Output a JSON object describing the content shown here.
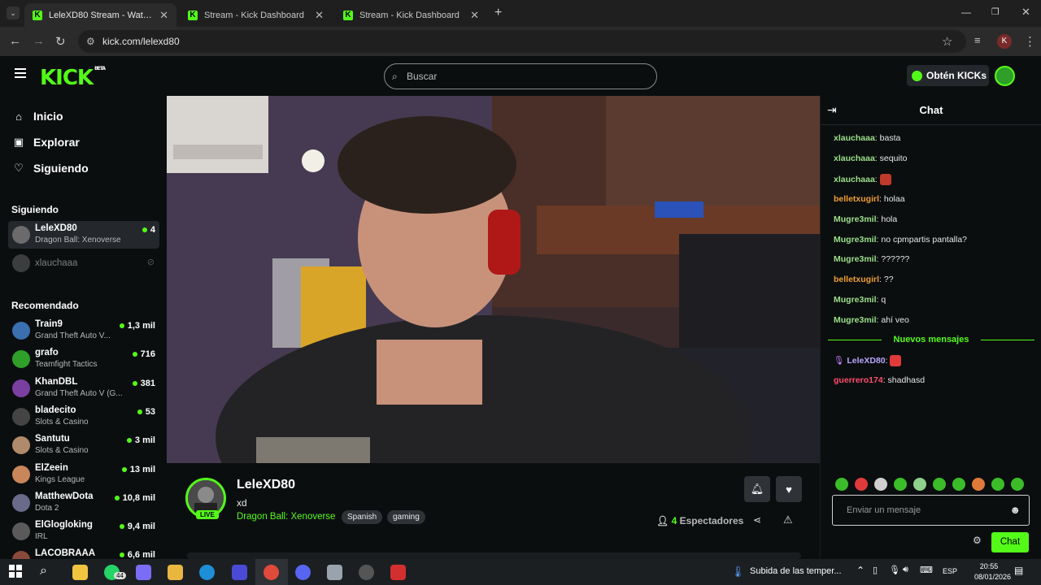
{
  "browser": {
    "tabs": [
      {
        "label": "LeleXD80 Stream - Watch Live on Kick",
        "active": true
      },
      {
        "label": "Stream - Kick Dashboard",
        "active": false
      },
      {
        "label": "Stream - Kick Dashboard",
        "active": false
      }
    ],
    "new_tab": "+",
    "url": "kick.com/lelexd80",
    "profile_initial": "K"
  },
  "header": {
    "logo": "KICK",
    "logo_badge": "BETA",
    "search_placeholder": "Buscar",
    "kicks_button": "Obtén KICKs"
  },
  "sidebar": {
    "nav": [
      {
        "label": "Inicio",
        "icon": "home-icon"
      },
      {
        "label": "Explorar",
        "icon": "compass-icon"
      },
      {
        "label": "Siguiendo",
        "icon": "heart-icon"
      }
    ],
    "following_heading": "Siguiendo",
    "following": [
      {
        "name": "LeleXD80",
        "category": "Dragon Ball: Xenoverse",
        "viewers": "4",
        "live": true
      },
      {
        "name": "xlauchaaa",
        "category": "",
        "viewers": "",
        "live": false
      }
    ],
    "recommended_heading": "Recomendado",
    "recommended": [
      {
        "name": "Train9",
        "category": "Grand Theft Auto V...",
        "viewers": "1,3 mil",
        "color": "#3a6fb0"
      },
      {
        "name": "grafo",
        "category": "Teamfight Tactics",
        "viewers": "716",
        "color": "#2f9f2a"
      },
      {
        "name": "KhanDBL",
        "category": "Grand Theft Auto V (G...",
        "viewers": "381",
        "color": "#7a3fa0"
      },
      {
        "name": "bladecito",
        "category": "Slots & Casino",
        "viewers": "53",
        "color": "#444444"
      },
      {
        "name": "Santutu",
        "category": "Slots & Casino",
        "viewers": "3 mil",
        "color": "#b08a6a"
      },
      {
        "name": "ElZeein",
        "category": "Kings League",
        "viewers": "13 mil",
        "color": "#c9865a"
      },
      {
        "name": "MatthewDota",
        "category": "Dota 2",
        "viewers": "10,8 mil",
        "color": "#6a6a8a"
      },
      {
        "name": "ElGlogloking",
        "category": "IRL",
        "viewers": "9,4 mil",
        "color": "#5a5a5a"
      },
      {
        "name": "LACOBRAAA",
        "category": "",
        "viewers": "6,6 mil",
        "color": "#8a4a3a"
      }
    ]
  },
  "stream": {
    "streamer": "LeleXD80",
    "title": "xd",
    "category": "Dragon Ball: Xenoverse",
    "tags": [
      "Spanish",
      "gaming"
    ],
    "live_badge": "LIVE",
    "viewer_count": "4",
    "viewers_label": "Espectadores"
  },
  "chat": {
    "title": "Chat",
    "messages": [
      {
        "user": "xlauchaaa",
        "text": "basta",
        "color": "#9be08a"
      },
      {
        "user": "xlauchaaa",
        "text": "sequito",
        "color": "#9be08a"
      },
      {
        "user": "xlauchaaa",
        "text": "",
        "color": "#9be08a",
        "emote": "#c0392b"
      },
      {
        "user": "belletxugirl",
        "text": "holaa",
        "color": "#f0a030"
      },
      {
        "user": "Mugre3mil",
        "text": "hola",
        "color": "#9be08a"
      },
      {
        "user": "Mugre3mil",
        "text": "no cpmpartis pantalla?",
        "color": "#9be08a"
      },
      {
        "user": "Mugre3mil",
        "text": "??????",
        "color": "#9be08a"
      },
      {
        "user": "belletxugirl",
        "text": "??",
        "color": "#f0a030"
      },
      {
        "user": "Mugre3mil",
        "text": "q",
        "color": "#9be08a"
      },
      {
        "user": "Mugre3mil",
        "text": "ahí veo",
        "color": "#9be08a"
      }
    ],
    "new_messages_label": "Nuevos mensajes",
    "new_messages": [
      {
        "user": "LeleXD80",
        "text": "",
        "color": "#b9a7ff",
        "emote": "#e03a3a",
        "broadcaster": true
      },
      {
        "user": "guerrero174",
        "text": "shadhasd",
        "color": "#ff4d6d"
      }
    ],
    "input_placeholder": "Enviar un mensaje",
    "send_label": "Chat"
  },
  "taskbar": {
    "whatsapp_badge": "44",
    "weather_text": "Subida de las temper...",
    "language": "ESP",
    "time": "20:55",
    "date": "08/01/2026"
  },
  "colors": {
    "accent": "#53fc18",
    "background": "#0b0e0f",
    "panel": "#24272c"
  }
}
